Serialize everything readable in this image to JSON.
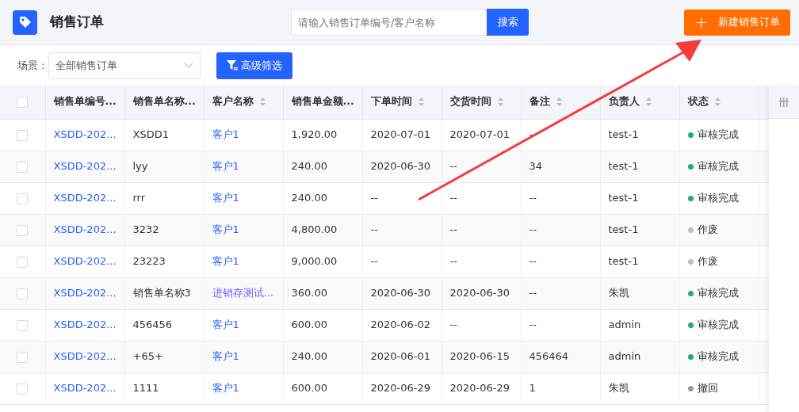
{
  "header": {
    "title": "销售订单",
    "search": {
      "placeholder": "请输入销售订单编号/客户名称",
      "button": "搜索"
    },
    "create_button": {
      "icon": "+",
      "label": "新建销售订单"
    }
  },
  "filters": {
    "scene_label": "场景：",
    "scene_value": "全部销售订单",
    "advanced_button": "高级筛选"
  },
  "table": {
    "select_all": {
      "checked": false
    },
    "columns": [
      {
        "label": "销售单编号...",
        "sortable": false
      },
      {
        "label": "销售单名称...",
        "sortable": false
      },
      {
        "label": "客户名称",
        "sortable": true
      },
      {
        "label": "销售单金额...",
        "sortable": false
      },
      {
        "label": "下单时间",
        "sortable": true
      },
      {
        "label": "交货时间",
        "sortable": true
      },
      {
        "label": "备注",
        "sortable": true
      },
      {
        "label": "负责人",
        "sortable": true
      },
      {
        "label": "状态",
        "sortable": true
      }
    ],
    "rows": [
      {
        "checked": false,
        "code": "XSDD-202...",
        "name": "XSDD1",
        "customer": "客户1",
        "amount": "1,920.00",
        "order_date": "2020-07-01",
        "delivery_date": "2020-07-01",
        "remark": "--",
        "owner": "test-1",
        "status": "审核完成",
        "color": "#1db35b"
      },
      {
        "checked": false,
        "code": "XSDD-202...",
        "name": "lyy",
        "customer": "客户1",
        "amount": "240.00",
        "order_date": "2020-06-30",
        "delivery_date": "--",
        "remark": "34",
        "owner": "test-1",
        "status": "审核完成",
        "color": "#1db35b"
      },
      {
        "checked": false,
        "code": "XSDD-202...",
        "name": "rrr",
        "customer": "客户1",
        "amount": "240.00",
        "order_date": "--",
        "delivery_date": "--",
        "remark": "--",
        "owner": "test-1",
        "status": "审核完成",
        "color": "#1db35b"
      },
      {
        "checked": false,
        "code": "XSDD-202...",
        "name": "3232",
        "customer": "客户1",
        "amount": "4,800.00",
        "order_date": "--",
        "delivery_date": "--",
        "remark": "--",
        "owner": "test-1",
        "status": "作废",
        "color": "#bfbfbf"
      },
      {
        "checked": false,
        "code": "XSDD-202...",
        "name": "23223",
        "customer": "客户1",
        "amount": "9,000.00",
        "order_date": "--",
        "delivery_date": "--",
        "remark": "--",
        "owner": "test-1",
        "status": "作废",
        "color": "#bfbfbf"
      },
      {
        "checked": false,
        "code": "XSDD-202...",
        "name": "销售单名称3",
        "customer": "进销存测试...",
        "amount": "360.00",
        "order_date": "2020-06-30",
        "delivery_date": "2020-06-30",
        "remark": "--",
        "owner": "朱凯",
        "status": "审核完成",
        "color": "#1db35b"
      },
      {
        "checked": false,
        "code": "XSDD-202...",
        "name": "456456",
        "customer": "客户1",
        "amount": "600.00",
        "order_date": "2020-06-02",
        "delivery_date": "--",
        "remark": "--",
        "owner": "admin",
        "status": "审核完成",
        "color": "#1db35b"
      },
      {
        "checked": false,
        "code": "XSDD-202...",
        "name": "+65+",
        "customer": "客户1",
        "amount": "240.00",
        "order_date": "2020-06-01",
        "delivery_date": "2020-06-15",
        "remark": "456464",
        "owner": "admin",
        "status": "审核完成",
        "color": "#1db35b"
      },
      {
        "checked": false,
        "code": "XSDD-202...",
        "name": "1111",
        "customer": "客户1",
        "amount": "600.00",
        "order_date": "2020-06-29",
        "delivery_date": "2020-06-29",
        "remark": "1",
        "owner": "朱凯",
        "status": "撤回",
        "color": "#999999"
      }
    ]
  }
}
